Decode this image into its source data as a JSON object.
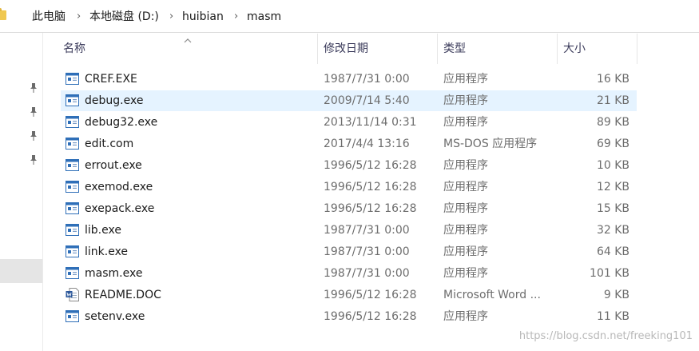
{
  "breadcrumb": {
    "items": [
      "此电脑",
      "本地磁盘 (D:)",
      "huibian",
      "masm"
    ],
    "separator": "›"
  },
  "columns": {
    "name": "名称",
    "modified": "修改日期",
    "type": "类型",
    "size": "大小"
  },
  "files": [
    {
      "name": "CREF.EXE",
      "modified": "1987/7/31 0:00",
      "type": "应用程序",
      "size": "16 KB",
      "icon": "exe-icon"
    },
    {
      "name": "debug.exe",
      "modified": "2009/7/14 5:40",
      "type": "应用程序",
      "size": "21 KB",
      "icon": "exe-icon",
      "selected": true
    },
    {
      "name": "debug32.exe",
      "modified": "2013/11/14 0:31",
      "type": "应用程序",
      "size": "89 KB",
      "icon": "exe-icon"
    },
    {
      "name": "edit.com",
      "modified": "2017/4/4 13:16",
      "type": "MS-DOS 应用程序",
      "size": "69 KB",
      "icon": "exe-icon"
    },
    {
      "name": "errout.exe",
      "modified": "1996/5/12 16:28",
      "type": "应用程序",
      "size": "10 KB",
      "icon": "exe-icon"
    },
    {
      "name": "exemod.exe",
      "modified": "1996/5/12 16:28",
      "type": "应用程序",
      "size": "12 KB",
      "icon": "exe-icon"
    },
    {
      "name": "exepack.exe",
      "modified": "1996/5/12 16:28",
      "type": "应用程序",
      "size": "15 KB",
      "icon": "exe-icon"
    },
    {
      "name": "lib.exe",
      "modified": "1987/7/31 0:00",
      "type": "应用程序",
      "size": "32 KB",
      "icon": "exe-icon"
    },
    {
      "name": "link.exe",
      "modified": "1987/7/31 0:00",
      "type": "应用程序",
      "size": "64 KB",
      "icon": "exe-icon"
    },
    {
      "name": "masm.exe",
      "modified": "1987/7/31 0:00",
      "type": "应用程序",
      "size": "101 KB",
      "icon": "exe-icon"
    },
    {
      "name": "README.DOC",
      "modified": "1996/5/12 16:28",
      "type": "Microsoft Word ...",
      "size": "9 KB",
      "icon": "word-doc-icon"
    },
    {
      "name": "setenv.exe",
      "modified": "1996/5/12 16:28",
      "type": "应用程序",
      "size": "11 KB",
      "icon": "exe-icon"
    }
  ],
  "watermark": "https://blog.csdn.net/freeking101",
  "colors": {
    "selection": "#e5f3ff",
    "exe_icon_blue": "#2f6fb8",
    "word_icon_blue": "#2b579a"
  }
}
